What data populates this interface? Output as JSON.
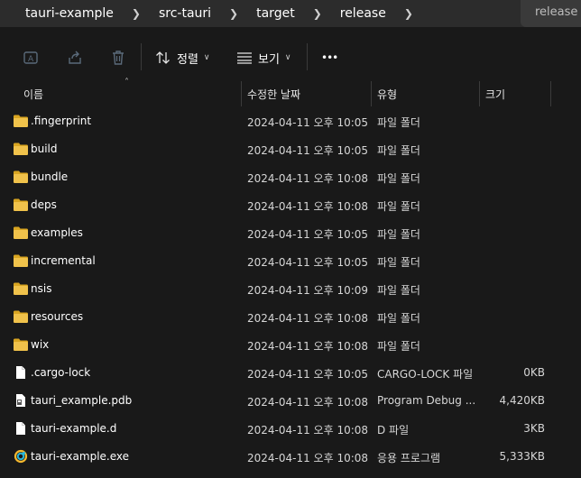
{
  "breadcrumb": [
    {
      "label": "tauri-example"
    },
    {
      "label": "src-tauri"
    },
    {
      "label": "target"
    },
    {
      "label": "release"
    }
  ],
  "search": {
    "text": "release"
  },
  "toolbar": {
    "sort_label": "정렬",
    "view_label": "보기",
    "more_label": "•••"
  },
  "columns": {
    "name": "이름",
    "modified": "수정한 날짜",
    "type": "유형",
    "size": "크기"
  },
  "files": [
    {
      "name": ".fingerprint",
      "date": "2024-04-11 오후 10:05",
      "type": "파일 폴더",
      "size": "",
      "icon": "folder-icon"
    },
    {
      "name": "build",
      "date": "2024-04-11 오후 10:05",
      "type": "파일 폴더",
      "size": "",
      "icon": "folder-icon"
    },
    {
      "name": "bundle",
      "date": "2024-04-11 오후 10:08",
      "type": "파일 폴더",
      "size": "",
      "icon": "folder-icon"
    },
    {
      "name": "deps",
      "date": "2024-04-11 오후 10:08",
      "type": "파일 폴더",
      "size": "",
      "icon": "folder-icon"
    },
    {
      "name": "examples",
      "date": "2024-04-11 오후 10:05",
      "type": "파일 폴더",
      "size": "",
      "icon": "folder-icon"
    },
    {
      "name": "incremental",
      "date": "2024-04-11 오후 10:05",
      "type": "파일 폴더",
      "size": "",
      "icon": "folder-icon"
    },
    {
      "name": "nsis",
      "date": "2024-04-11 오후 10:09",
      "type": "파일 폴더",
      "size": "",
      "icon": "folder-icon"
    },
    {
      "name": "resources",
      "date": "2024-04-11 오후 10:08",
      "type": "파일 폴더",
      "size": "",
      "icon": "folder-icon"
    },
    {
      "name": "wix",
      "date": "2024-04-11 오후 10:08",
      "type": "파일 폴더",
      "size": "",
      "icon": "folder-icon"
    },
    {
      "name": ".cargo-lock",
      "date": "2024-04-11 오후 10:05",
      "type": "CARGO-LOCK 파일",
      "size": "0KB",
      "icon": "file-icon"
    },
    {
      "name": "tauri_example.pdb",
      "date": "2024-04-11 오후 10:08",
      "type": "Program Debug ...",
      "size": "4,420KB",
      "icon": "pdb-file-icon"
    },
    {
      "name": "tauri-example.d",
      "date": "2024-04-11 오후 10:08",
      "type": "D 파일",
      "size": "3KB",
      "icon": "file-icon"
    },
    {
      "name": "tauri-example.exe",
      "date": "2024-04-11 오후 10:08",
      "type": "응용 프로그램",
      "size": "5,333KB",
      "icon": "exe-icon"
    }
  ],
  "colors": {
    "background": "#191919",
    "address_bar": "#2c2c2c",
    "folder": "#f0c24b",
    "folder_dark": "#d9a521"
  }
}
